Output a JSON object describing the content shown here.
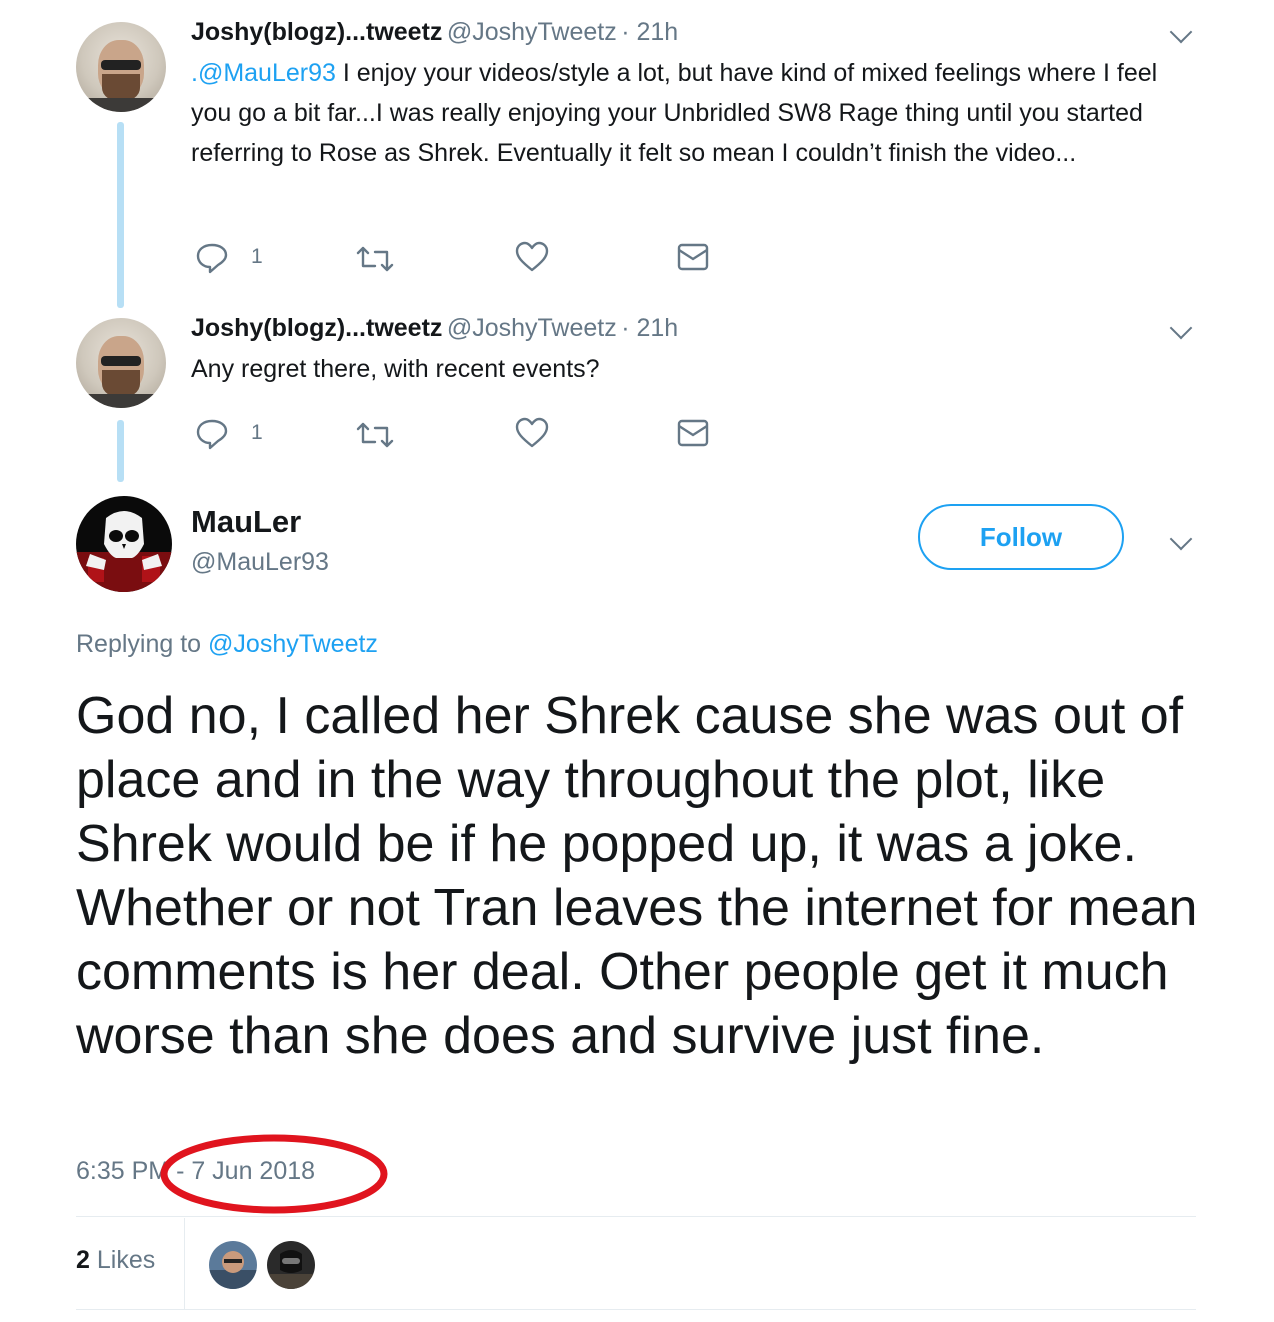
{
  "tweet1": {
    "name": "Joshy(blogz)...tweetz",
    "handle": "@JoshyTweetz",
    "time": "· 21h",
    "mention": ".@MauLer93",
    "text": " I enjoy your videos/style a lot, but have kind of mixed feelings where I feel you go a bit far...I was really enjoying your Unbridled SW8 Rage thing until you started referring to Rose as Shrek. Eventually it felt so mean I couldn’t finish the video...",
    "reply_count": "1"
  },
  "tweet2": {
    "name": "Joshy(blogz)...tweetz",
    "handle": "@JoshyTweetz",
    "time": "· 21h",
    "text": "Any regret there, with recent events?",
    "reply_count": "1"
  },
  "main_tweet": {
    "name": "MauLer",
    "handle": "@MauLer93",
    "follow_label": "Follow",
    "replying_label": "Replying to ",
    "replying_handle": "@JoshyTweetz",
    "text": "God no, I called her Shrek cause she was out of place and in the way throughout the plot, like Shrek would be if he popped up, it was a joke. Whether or not Tran leaves the internet for mean comments is her deal. Other people get it much worse than she does and survive just fine.",
    "time": "6:35 PM",
    "date": "- 7 Jun 2018",
    "likes_count": "2",
    "likes_label": "Likes"
  },
  "colors": {
    "accent": "#1da1f2",
    "secondary_text": "#657786",
    "thread_line": "#b7dff5",
    "annotation": "#e0141e"
  },
  "icons": [
    "reply-icon",
    "retweet-icon",
    "like-icon",
    "message-icon",
    "chevron-down-icon"
  ]
}
